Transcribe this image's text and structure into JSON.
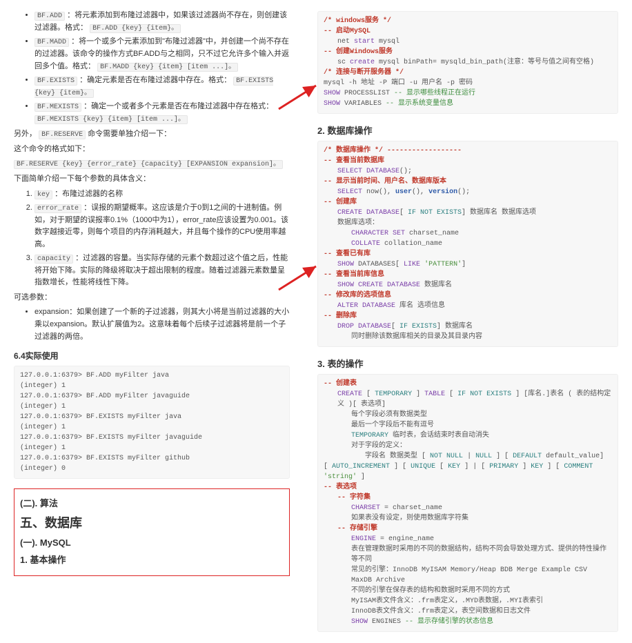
{
  "left": {
    "bf_list": [
      {
        "cmd": "BF.ADD",
        "desc": "：将元素添加到布隆过滤器中，如果该过滤器尚不存在，则创建该过滤器。格式：",
        "tail": "BF.ADD {key} {item}。"
      },
      {
        "cmd": "BF.MADD",
        "desc": "：将一个或多个元素添加到\"布隆过滤器\"中，并创建一个尚不存在的过滤器。该命令的操作方式BF.ADD与之相同，只不过它允许多个输入并返回多个值。格式：",
        "tail": "BF.MADD {key} {item} [item ...]。"
      },
      {
        "cmd": "BF.EXISTS",
        "desc": "：确定元素是否在布隆过滤器中存在。格式：",
        "tail": "BF.EXISTS {key} {item}。"
      },
      {
        "cmd": "BF.MEXISTS",
        "desc": "：确定一个或者多个元素是否在布隆过滤器中存在格式：",
        "tail": "BF.MEXISTS {key} {item} [item ...]。"
      }
    ],
    "extra_p1_pre": "另外，",
    "extra_p1_code": "BF.RESERVE",
    "extra_p1_post": " 命令需要单独介绍一下：",
    "extra_p2": "这个命令的格式如下：",
    "reserve_fmt": "BF.RESERVE {key} {error_rate} {capacity} [EXPANSION expansion]。",
    "extra_p3": "下面简单介绍一下每个参数的具体含义：",
    "params": [
      {
        "name": "key",
        "desc": "：布隆过滤器的名称"
      },
      {
        "name": "error_rate",
        "desc": "：误报的期望概率。这应该是介于0到1之间的十进制值。例如，对于期望的误报率0.1%（1000中为1），error_rate应该设置为0.001。该数字越接近零，则每个项目的内存消耗越大，并且每个操作的CPU使用率越高。"
      },
      {
        "name": "capacity",
        "desc": "：过滤器的容量。当实际存储的元素个数超过这个值之后，性能将开始下降。实际的降级将取决于超出限制的程度。随着过滤器元素数量呈指数增长，性能将线性下降。"
      }
    ],
    "optional_label": "可选参数：",
    "optional_item": "expansion：如果创建了一个新的子过滤器，则其大小将是当前过滤器的大小乘以expansion。默认扩展值为2。这意味着每个后续子过滤器将是前一个子过滤器的两倍。",
    "h64": "6.4实际使用",
    "console": "127.0.0.1:6379> BF.ADD myFilter java\n(integer) 1\n127.0.0.1:6379> BF.ADD myFilter javaguide\n(integer) 1\n127.0.0.1:6379> BF.EXISTS myFilter java\n(integer) 1\n127.0.0.1:6379> BF.EXISTS myFilter javaguide\n(integer) 1\n127.0.0.1:6379> BF.EXISTS myFilter github\n(integer) 0",
    "redbox": {
      "h1": "(二). 算法",
      "h2": "五、数据库",
      "h3": "(一). MySQL",
      "h4": "1. 基本操作"
    }
  },
  "right": {
    "block1": {
      "l1": "/* windows服务 */",
      "l2a": "-- ",
      "l2b": "启动MySQL",
      "l3a": "net ",
      "l3b": "start",
      "l3c": " mysql",
      "l4a": "-- ",
      "l4b": "创建Windows服务",
      "l5a": "sc ",
      "l5b": "create",
      "l5c": " mysql binPath= mysqld_bin_path(注意：等号与值之间有空格)",
      "l6": "/* 连接与断开服务器 */",
      "l7": "mysql -h 地址 -P 端口 -u 用户名 -p 密码",
      "l8a": "SHOW",
      "l8b": " PROCESSLIST ",
      "l8c": "-- 显示哪些线程正在运行",
      "l9a": "SHOW",
      "l9b": " VARIABLES ",
      "l9c": "-- 显示系统变量信息"
    },
    "h2": "2. 数据库操作",
    "block2": {
      "lines": [
        {
          "type": "cmt2",
          "t": "/* 数据库操作 */ ------------------"
        },
        {
          "type": "cmt",
          "t1": "-- ",
          "t2": "查看当前数据库"
        },
        {
          "type": "code",
          "t1": "SELECT DATABASE",
          "t2": "();"
        },
        {
          "type": "cmt",
          "t1": "-- ",
          "t2": "显示当前时间、用户名、数据库版本"
        },
        {
          "type": "code",
          "t1": "SELECT",
          "t2": " now(), ",
          "t3": "user",
          "t4": "(), ",
          "t5": "version",
          "t6": "();"
        },
        {
          "type": "cmt",
          "t1": "-- ",
          "t2": "创建库"
        },
        {
          "type": "code",
          "t1": "CREATE DATABASE",
          "t2": "[ ",
          "t3": "IF NOT EXISTS",
          "t4": "] 数据库名 数据库选项"
        },
        {
          "type": "plain",
          "t": "数据库选项："
        },
        {
          "type": "code2",
          "t1": "CHARACTER SET",
          "t2": " charset_name"
        },
        {
          "type": "code2",
          "t1": "COLLATE",
          "t2": " collation_name"
        },
        {
          "type": "cmt",
          "t1": "-- ",
          "t2": "查看已有库"
        },
        {
          "type": "code",
          "t1": "SHOW",
          "t2": " DATABASES[ ",
          "t3": "LIKE",
          "t4": " ",
          "t5": "'PATTERN'",
          "t6": "]"
        },
        {
          "type": "cmt",
          "t1": "-- ",
          "t2": "查看当前库信息"
        },
        {
          "type": "code",
          "t1": "SHOW CREATE DATABASE",
          "t2": " 数据库名"
        },
        {
          "type": "cmt",
          "t1": "-- ",
          "t2": "修改库的选项信息"
        },
        {
          "type": "code",
          "t1": "ALTER DATABASE",
          "t2": " 库名 选项信息"
        },
        {
          "type": "cmt",
          "t1": "-- ",
          "t2": "删除库"
        },
        {
          "type": "code",
          "t1": "DROP DATABASE",
          "t2": "[ ",
          "t3": "IF EXISTS",
          "t4": "] 数据库名"
        },
        {
          "type": "plain2",
          "t": "同时删除该数据库相关的目录及其目录内容"
        }
      ]
    },
    "h3": "3. 表的操作",
    "block3": {
      "l1a": "-- ",
      "l1b": "创建表",
      "l2a": "CREATE",
      "l2b": " [",
      "l2c": "TEMPORARY",
      "l2d": "] ",
      "l2e": "TABLE",
      "l2f": "[ ",
      "l2g": "IF NOT EXISTS",
      "l2h": "] [库名.]表名 ( 表的结构定义 )[ 表选项]",
      "l3": "每个字段必须有数据类型",
      "l4": "最后一个字段后不能有逗号",
      "l5a": "TEMPORARY",
      "l5b": " 临时表，会话结束时表自动消失",
      "l6": "对于字段的定义：",
      "l7a": "字段名 数据类型 [",
      "l7b": "NOT NULL",
      "l7c": " | ",
      "l7d": "NULL",
      "l7e": "] [",
      "l7f": "DEFAULT",
      "l7g": " default_value]",
      "l8a": "[",
      "l8b": "AUTO_INCREMENT",
      "l8c": "] [",
      "l8d": "UNIQUE",
      "l8e": " [",
      "l8f": "KEY",
      "l8g": "] | [",
      "l8h": "PRIMARY",
      "l8i": "] ",
      "l8j": "KEY",
      "l8k": "] [",
      "l8l": "COMMENT",
      "l8m": " ",
      "l8n": "'string'",
      "l8o": "]",
      "l9a": "-- ",
      "l9b": "表选项",
      "l10a": "-- ",
      "l10b": "字符集",
      "l11a": "CHARSET",
      "l11b": " = charset_name",
      "l12": "如果表没有设定，则使用数据库字符集",
      "l13a": "-- ",
      "l13b": "存储引擎",
      "l14a": "ENGINE",
      "l14b": " = engine_name",
      "l15": "表在管理数据时采用的不同的数据结构，结构不同会导致处理方式、提供的特性操作等不同",
      "l16": "常见的引擎：InnoDB MyISAM Memory/Heap BDB Merge Example CSV MaxDB Archive",
      "l17": "不同的引擎在保存表的结构和数据时采用不同的方式",
      "l18": "MyISAM表文件含义：.frm表定义，.MYD表数据，.MYI表索引",
      "l19": "InnoDB表文件含义：.frm表定义，表空间数据和日志文件",
      "l20a": "SHOW",
      "l20b": " ENGINES ",
      "l20c": "-- 显示存储引擎的状态信息"
    }
  }
}
